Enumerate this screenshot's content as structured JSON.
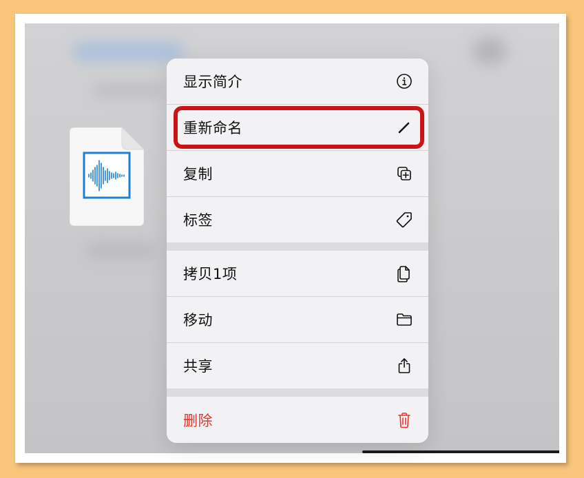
{
  "context_menu": {
    "items": [
      {
        "label": "显示简介",
        "icon": "info-circle-icon"
      },
      {
        "label": "重新命名",
        "icon": "pencil-icon"
      },
      {
        "label": "复制",
        "icon": "duplicate-icon"
      },
      {
        "label": "标签",
        "icon": "tag-icon"
      },
      {
        "label": "拷贝1项",
        "icon": "copy-document-icon"
      },
      {
        "label": "移动",
        "icon": "folder-icon"
      },
      {
        "label": "共享",
        "icon": "share-icon"
      },
      {
        "label": "删除",
        "icon": "trash-icon"
      }
    ],
    "highlighted_item": "重新命名"
  },
  "file_preview": {
    "icon": "audio-waveform-file-icon"
  },
  "colors": {
    "highlight_border": "#cc1416",
    "destructive": "#e5352b",
    "waveform": "#1e7fd6",
    "background": "#f9c57a"
  }
}
